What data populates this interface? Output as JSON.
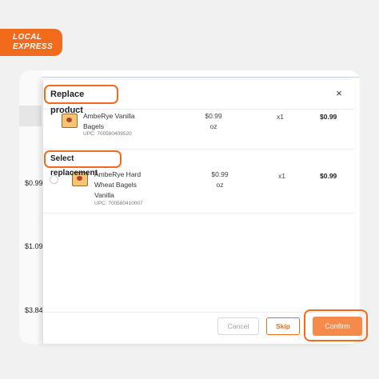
{
  "logo": {
    "line1": "LOCAL",
    "line2": "EXPRESS"
  },
  "background_prices": [
    "$0.99",
    "$1.09",
    "$3.84"
  ],
  "modal": {
    "title": "Replace product",
    "close_icon": "×",
    "original": {
      "name": "AmbeRye Vanilla Bagels",
      "upc": "UPC: 700580409520",
      "price": "$0.99",
      "unit": "oz",
      "qty": "x1",
      "total": "$0.99"
    },
    "select_label": "Select replacement",
    "replacement": {
      "name": "AmbeRye Hard Wheat Bagels Vanilla",
      "upc": "UPC: 700580410007",
      "price": "$0.99",
      "unit": "oz",
      "qty": "x1",
      "total": "$0.99"
    },
    "buttons": {
      "cancel": "Cancel",
      "skip": "Skip",
      "confirm": "Confirm"
    }
  },
  "colors": {
    "accent": "#f26b1d",
    "confirm_bg": "#f58a4b"
  }
}
